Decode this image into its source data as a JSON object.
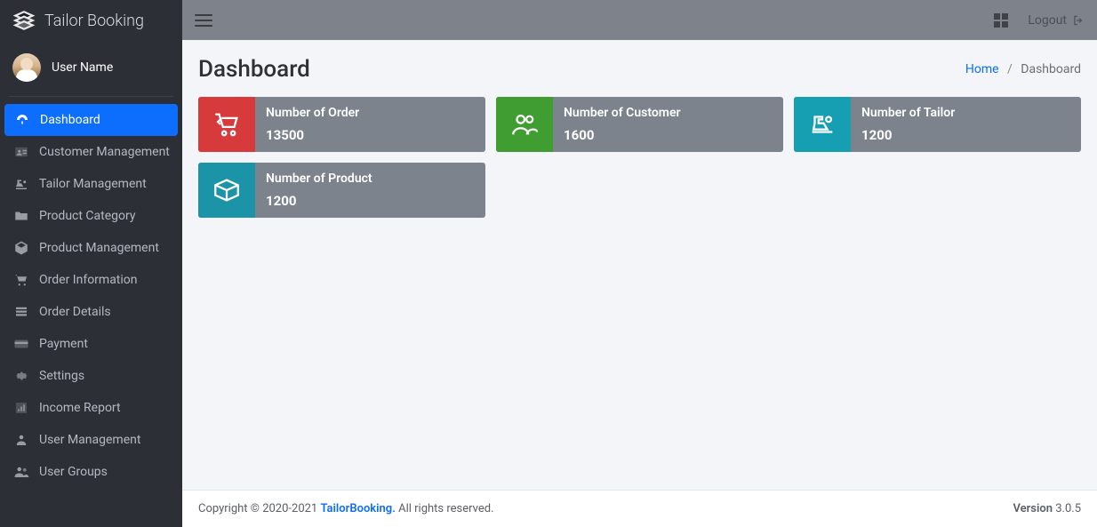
{
  "app": {
    "name": "Tailor Booking"
  },
  "user": {
    "display_name": "User Name"
  },
  "sidebar": {
    "items": [
      {
        "label": "Dashboard",
        "icon": "gauge-icon"
      },
      {
        "label": "Customer Management",
        "icon": "id-card-icon"
      },
      {
        "label": "Tailor Management",
        "icon": "sewing-icon"
      },
      {
        "label": "Product Category",
        "icon": "folder-icon"
      },
      {
        "label": "Product Management",
        "icon": "box-icon"
      },
      {
        "label": "Order Information",
        "icon": "cart-icon"
      },
      {
        "label": "Order Details",
        "icon": "list-icon"
      },
      {
        "label": "Payment",
        "icon": "payment-icon"
      },
      {
        "label": "Settings",
        "icon": "gear-icon"
      },
      {
        "label": "Income Report",
        "icon": "report-icon"
      },
      {
        "label": "User Management",
        "icon": "user-icon"
      },
      {
        "label": "User Groups",
        "icon": "users-icon"
      }
    ],
    "active_index": 0
  },
  "topbar": {
    "logout_label": "Logout"
  },
  "page": {
    "title": "Dashboard"
  },
  "breadcrumb": {
    "home": "Home",
    "current": "Dashboard",
    "sep": "/"
  },
  "cards": [
    {
      "title": "Number of Order",
      "value": "13500",
      "icon": "cart-icon",
      "tile": "tile-red"
    },
    {
      "title": "Number of Customer",
      "value": "1600",
      "icon": "users-icon",
      "tile": "tile-green"
    },
    {
      "title": "Number of Tailor",
      "value": "1200",
      "icon": "sewing-icon",
      "tile": "tile-blue"
    },
    {
      "title": "Number of Product",
      "value": "1200",
      "icon": "box-icon",
      "tile": "tile-teal"
    }
  ],
  "footer": {
    "copyright_prefix": "Copyright © 2020-2021 ",
    "brand": "TailorBooking.",
    "rights": " All rights reserved.",
    "version_label": "Version",
    "version": " 3.0.5"
  }
}
